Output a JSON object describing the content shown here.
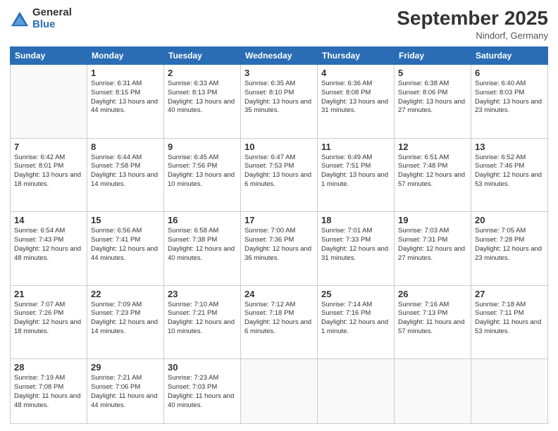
{
  "header": {
    "logo_general": "General",
    "logo_blue": "Blue",
    "month_title": "September 2025",
    "location": "Nindorf, Germany"
  },
  "days_of_week": [
    "Sunday",
    "Monday",
    "Tuesday",
    "Wednesday",
    "Thursday",
    "Friday",
    "Saturday"
  ],
  "weeks": [
    [
      {
        "day": "",
        "info": ""
      },
      {
        "day": "1",
        "info": "Sunrise: 6:31 AM\nSunset: 8:15 PM\nDaylight: 13 hours\nand 44 minutes."
      },
      {
        "day": "2",
        "info": "Sunrise: 6:33 AM\nSunset: 8:13 PM\nDaylight: 13 hours\nand 40 minutes."
      },
      {
        "day": "3",
        "info": "Sunrise: 6:35 AM\nSunset: 8:10 PM\nDaylight: 13 hours\nand 35 minutes."
      },
      {
        "day": "4",
        "info": "Sunrise: 6:36 AM\nSunset: 8:08 PM\nDaylight: 13 hours\nand 31 minutes."
      },
      {
        "day": "5",
        "info": "Sunrise: 6:38 AM\nSunset: 8:06 PM\nDaylight: 13 hours\nand 27 minutes."
      },
      {
        "day": "6",
        "info": "Sunrise: 6:40 AM\nSunset: 8:03 PM\nDaylight: 13 hours\nand 23 minutes."
      }
    ],
    [
      {
        "day": "7",
        "info": "Sunrise: 6:42 AM\nSunset: 8:01 PM\nDaylight: 13 hours\nand 18 minutes."
      },
      {
        "day": "8",
        "info": "Sunrise: 6:44 AM\nSunset: 7:58 PM\nDaylight: 13 hours\nand 14 minutes."
      },
      {
        "day": "9",
        "info": "Sunrise: 6:45 AM\nSunset: 7:56 PM\nDaylight: 13 hours\nand 10 minutes."
      },
      {
        "day": "10",
        "info": "Sunrise: 6:47 AM\nSunset: 7:53 PM\nDaylight: 13 hours\nand 6 minutes."
      },
      {
        "day": "11",
        "info": "Sunrise: 6:49 AM\nSunset: 7:51 PM\nDaylight: 13 hours\nand 1 minute."
      },
      {
        "day": "12",
        "info": "Sunrise: 6:51 AM\nSunset: 7:48 PM\nDaylight: 12 hours\nand 57 minutes."
      },
      {
        "day": "13",
        "info": "Sunrise: 6:52 AM\nSunset: 7:46 PM\nDaylight: 12 hours\nand 53 minutes."
      }
    ],
    [
      {
        "day": "14",
        "info": "Sunrise: 6:54 AM\nSunset: 7:43 PM\nDaylight: 12 hours\nand 48 minutes."
      },
      {
        "day": "15",
        "info": "Sunrise: 6:56 AM\nSunset: 7:41 PM\nDaylight: 12 hours\nand 44 minutes."
      },
      {
        "day": "16",
        "info": "Sunrise: 6:58 AM\nSunset: 7:38 PM\nDaylight: 12 hours\nand 40 minutes."
      },
      {
        "day": "17",
        "info": "Sunrise: 7:00 AM\nSunset: 7:36 PM\nDaylight: 12 hours\nand 36 minutes."
      },
      {
        "day": "18",
        "info": "Sunrise: 7:01 AM\nSunset: 7:33 PM\nDaylight: 12 hours\nand 31 minutes."
      },
      {
        "day": "19",
        "info": "Sunrise: 7:03 AM\nSunset: 7:31 PM\nDaylight: 12 hours\nand 27 minutes."
      },
      {
        "day": "20",
        "info": "Sunrise: 7:05 AM\nSunset: 7:28 PM\nDaylight: 12 hours\nand 23 minutes."
      }
    ],
    [
      {
        "day": "21",
        "info": "Sunrise: 7:07 AM\nSunset: 7:26 PM\nDaylight: 12 hours\nand 18 minutes."
      },
      {
        "day": "22",
        "info": "Sunrise: 7:09 AM\nSunset: 7:23 PM\nDaylight: 12 hours\nand 14 minutes."
      },
      {
        "day": "23",
        "info": "Sunrise: 7:10 AM\nSunset: 7:21 PM\nDaylight: 12 hours\nand 10 minutes."
      },
      {
        "day": "24",
        "info": "Sunrise: 7:12 AM\nSunset: 7:18 PM\nDaylight: 12 hours\nand 6 minutes."
      },
      {
        "day": "25",
        "info": "Sunrise: 7:14 AM\nSunset: 7:16 PM\nDaylight: 12 hours\nand 1 minute."
      },
      {
        "day": "26",
        "info": "Sunrise: 7:16 AM\nSunset: 7:13 PM\nDaylight: 11 hours\nand 57 minutes."
      },
      {
        "day": "27",
        "info": "Sunrise: 7:18 AM\nSunset: 7:11 PM\nDaylight: 11 hours\nand 53 minutes."
      }
    ],
    [
      {
        "day": "28",
        "info": "Sunrise: 7:19 AM\nSunset: 7:08 PM\nDaylight: 11 hours\nand 48 minutes."
      },
      {
        "day": "29",
        "info": "Sunrise: 7:21 AM\nSunset: 7:06 PM\nDaylight: 11 hours\nand 44 minutes."
      },
      {
        "day": "30",
        "info": "Sunrise: 7:23 AM\nSunset: 7:03 PM\nDaylight: 11 hours\nand 40 minutes."
      },
      {
        "day": "",
        "info": ""
      },
      {
        "day": "",
        "info": ""
      },
      {
        "day": "",
        "info": ""
      },
      {
        "day": "",
        "info": ""
      }
    ]
  ]
}
